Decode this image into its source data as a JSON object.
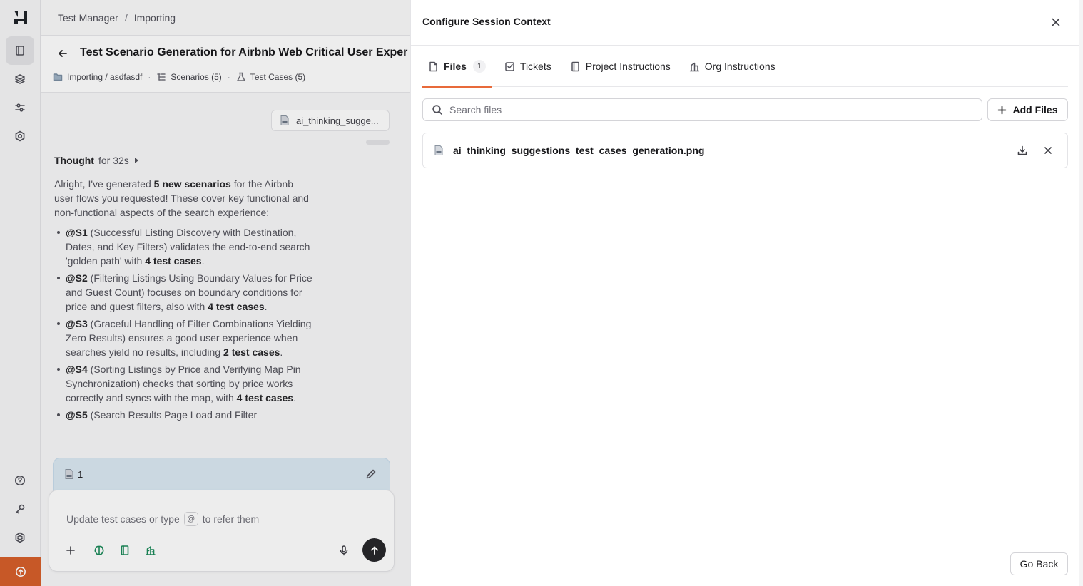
{
  "breadcrumb": {
    "root": "Test Manager",
    "separator": "/",
    "current": "Importing"
  },
  "page": {
    "title": "Test Scenario Generation for Airbnb Web Critical User Exper",
    "crumbs": [
      {
        "label": "Importing / asdfasdf",
        "icon": "folder-icon"
      },
      {
        "label": "Scenarios (5)",
        "icon": "list-tree-icon"
      },
      {
        "label": "Test Cases (5)",
        "icon": "flask-icon"
      }
    ]
  },
  "chat": {
    "attachment_label": "ai_thinking_sugge...",
    "thought_prefix": "Thought",
    "thought_duration": "for 32s",
    "message": {
      "intro_1": "Alright, I've generated ",
      "intro_bold": "5 new scenarios",
      "intro_2": " for the Airbnb user flows you requested! These cover key functional and non-functional aspects of the search experience:",
      "items": [
        {
          "id": "@S1",
          "text": " (Successful Listing Discovery with Destination, Dates, and Key Filters) validates the end-to-end search 'golden path' with ",
          "count": "4 test cases",
          "tail": "."
        },
        {
          "id": "@S2",
          "text": " (Filtering Listings Using Boundary Values for Price and Guest Count) focuses on boundary conditions for price and guest filters, also with ",
          "count": "4 test cases",
          "tail": "."
        },
        {
          "id": "@S3",
          "text": " (Graceful Handling of Filter Combinations Yielding Zero Results) ensures a good user experience when searches yield no results, including ",
          "count": "2 test cases",
          "tail": "."
        },
        {
          "id": "@S4",
          "text": " (Sorting Listings by Price and Verifying Map Pin Synchronization) checks that sorting by price works correctly and syncs with the map, with ",
          "count": "4 test cases",
          "tail": "."
        },
        {
          "id": "@S5",
          "text": " (Search Results Page Load and Filter",
          "count": "",
          "tail": ""
        }
      ]
    },
    "context_count": "1",
    "composer": {
      "placeholder_before": "Update test cases or type",
      "at_symbol": "@",
      "placeholder_after": "to refer them"
    }
  },
  "panel": {
    "title": "Configure Session Context",
    "tabs": [
      {
        "label": "Files",
        "badge": "1",
        "icon": "file-icon"
      },
      {
        "label": "Tickets",
        "icon": "check-square-icon"
      },
      {
        "label": "Project Instructions",
        "icon": "notebook-icon"
      },
      {
        "label": "Org Instructions",
        "icon": "building-icon"
      }
    ],
    "search_placeholder": "Search files",
    "add_files_label": "Add Files",
    "files": [
      {
        "name": "ai_thinking_suggestions_test_cases_generation.png"
      }
    ],
    "go_back_label": "Go Back"
  },
  "colors": {
    "accent": "#e86a3a",
    "upgrade": "#d75f2a",
    "context_card": "#dbe9f3"
  }
}
